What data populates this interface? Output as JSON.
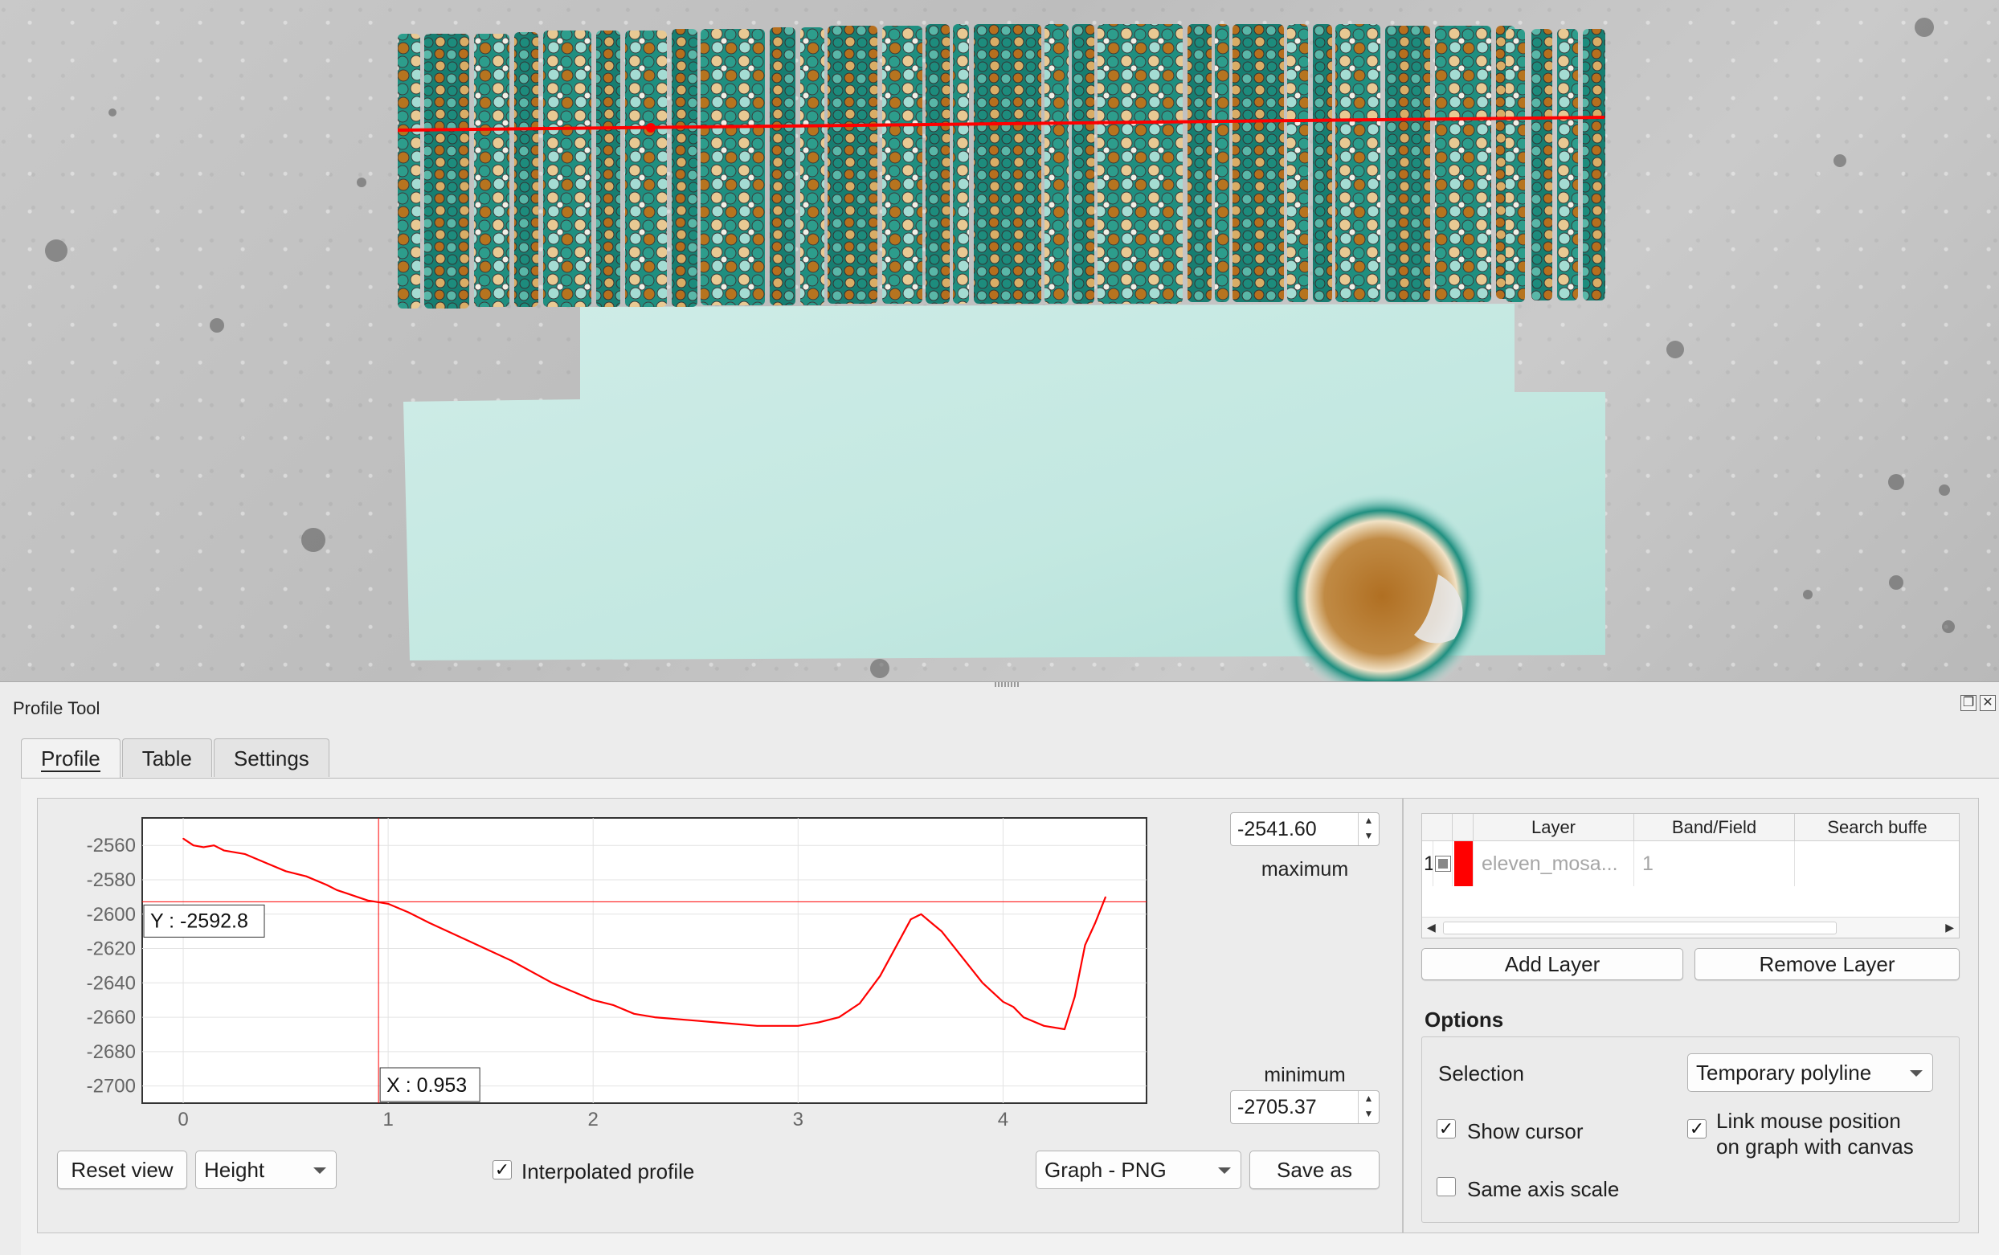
{
  "colors": {
    "profile_line": "#ff0000",
    "teal_dark": "#1a8f80",
    "teal_light": "#c9ece6",
    "brown": "#b5701f",
    "layer_color": "#ff0000"
  },
  "dock": {
    "title": "Profile Tool",
    "float_icon": "float-icon",
    "close_icon": "close-icon"
  },
  "tabs": [
    {
      "label": "Profile",
      "active": true
    },
    {
      "label": "Table",
      "active": false
    },
    {
      "label": "Settings",
      "active": false
    }
  ],
  "graph": {
    "max_value": "-2541.60",
    "max_label": "maximum",
    "min_value": "-2705.37",
    "min_label": "minimum",
    "cursor_y_label": "Y : -2592.8",
    "cursor_x_label": "X : 0.953",
    "cursor_x": 0.953,
    "cursor_y": -2592.8,
    "reset_view": "Reset view",
    "mode_select": "Height",
    "interpolated_label": "Interpolated profile",
    "interpolated_checked": true,
    "export_select": "Graph - PNG",
    "save_as": "Save as"
  },
  "chart_data": {
    "type": "line",
    "xlim": [
      -0.2,
      4.7
    ],
    "ylim": [
      -2710,
      -2544
    ],
    "x_ticks": [
      "0",
      "1",
      "2",
      "3",
      "4"
    ],
    "y_ticks": [
      "-2560",
      "-2580",
      "-2600",
      "-2620",
      "-2640",
      "-2660",
      "-2680",
      "-2700"
    ],
    "grid": true,
    "series": [
      {
        "color": "#ff0000",
        "x": [
          0,
          0.05,
          0.1,
          0.15,
          0.2,
          0.3,
          0.4,
          0.5,
          0.6,
          0.7,
          0.75,
          0.8,
          0.85,
          0.9,
          0.95,
          1.0,
          1.1,
          1.2,
          1.4,
          1.6,
          1.8,
          1.9,
          2.0,
          2.1,
          2.2,
          2.3,
          2.5,
          2.7,
          2.8,
          2.9,
          3.0,
          3.1,
          3.2,
          3.3,
          3.4,
          3.5,
          3.55,
          3.6,
          3.65,
          3.7,
          3.8,
          3.9,
          4.0,
          4.05,
          4.1,
          4.2,
          4.3,
          4.35,
          4.4,
          4.45,
          4.5
        ],
        "y": [
          -2556,
          -2560,
          -2561,
          -2560,
          -2563,
          -2565,
          -2570,
          -2575,
          -2578,
          -2583,
          -2586,
          -2588,
          -2590,
          -2592,
          -2593,
          -2594,
          -2599,
          -2605,
          -2616,
          -2627,
          -2640,
          -2645,
          -2650,
          -2653,
          -2658,
          -2660,
          -2662,
          -2664,
          -2665,
          -2665,
          -2665,
          -2663,
          -2660,
          -2652,
          -2636,
          -2614,
          -2603,
          -2600,
          -2605,
          -2610,
          -2625,
          -2640,
          -2651,
          -2654,
          -2660,
          -2665,
          -2667,
          -2648,
          -2618,
          -2605,
          -2590
        ]
      }
    ]
  },
  "layers_table": {
    "headers": [
      "Layer",
      "Band/Field",
      "Search buffe"
    ],
    "rows": [
      {
        "index": "1",
        "layer": "eleven_mosa...",
        "band": "1",
        "color": "#ff0000"
      }
    ],
    "add_layer": "Add Layer",
    "remove_layer": "Remove Layer"
  },
  "options": {
    "title": "Options",
    "selection_label": "Selection",
    "selection_value": "Temporary polyline",
    "show_cursor": "Show cursor",
    "show_cursor_checked": true,
    "link_mouse_line1": "Link mouse position",
    "link_mouse_line2": "on graph with canvas",
    "link_mouse_checked": true,
    "same_axis": "Same axis scale",
    "same_axis_checked": false
  }
}
